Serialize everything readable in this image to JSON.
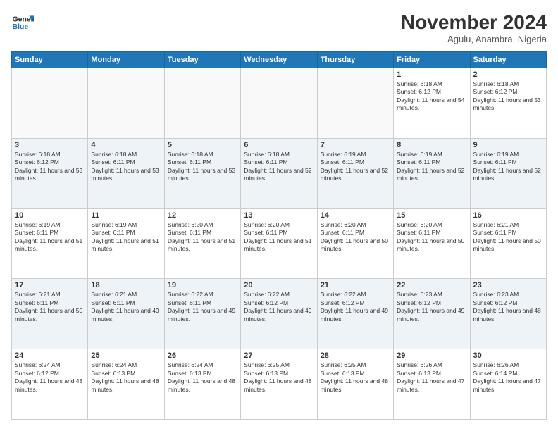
{
  "header": {
    "logo_line1": "General",
    "logo_line2": "Blue",
    "month": "November 2024",
    "location": "Agulu, Anambra, Nigeria"
  },
  "weekdays": [
    "Sunday",
    "Monday",
    "Tuesday",
    "Wednesday",
    "Thursday",
    "Friday",
    "Saturday"
  ],
  "weeks": [
    [
      {
        "day": "",
        "empty": true
      },
      {
        "day": "",
        "empty": true
      },
      {
        "day": "",
        "empty": true
      },
      {
        "day": "",
        "empty": true
      },
      {
        "day": "",
        "empty": true
      },
      {
        "day": "1",
        "rise": "6:18 AM",
        "set": "6:12 PM",
        "daylight": "11 hours and 54 minutes."
      },
      {
        "day": "2",
        "rise": "6:18 AM",
        "set": "6:12 PM",
        "daylight": "11 hours and 53 minutes."
      }
    ],
    [
      {
        "day": "3",
        "rise": "6:18 AM",
        "set": "6:12 PM",
        "daylight": "11 hours and 53 minutes."
      },
      {
        "day": "4",
        "rise": "6:18 AM",
        "set": "6:11 PM",
        "daylight": "11 hours and 53 minutes."
      },
      {
        "day": "5",
        "rise": "6:18 AM",
        "set": "6:11 PM",
        "daylight": "11 hours and 53 minutes."
      },
      {
        "day": "6",
        "rise": "6:18 AM",
        "set": "6:11 PM",
        "daylight": "11 hours and 52 minutes."
      },
      {
        "day": "7",
        "rise": "6:19 AM",
        "set": "6:11 PM",
        "daylight": "11 hours and 52 minutes."
      },
      {
        "day": "8",
        "rise": "6:19 AM",
        "set": "6:11 PM",
        "daylight": "11 hours and 52 minutes."
      },
      {
        "day": "9",
        "rise": "6:19 AM",
        "set": "6:11 PM",
        "daylight": "11 hours and 52 minutes."
      }
    ],
    [
      {
        "day": "10",
        "rise": "6:19 AM",
        "set": "6:11 PM",
        "daylight": "11 hours and 51 minutes."
      },
      {
        "day": "11",
        "rise": "6:19 AM",
        "set": "6:11 PM",
        "daylight": "11 hours and 51 minutes."
      },
      {
        "day": "12",
        "rise": "6:20 AM",
        "set": "6:11 PM",
        "daylight": "11 hours and 51 minutes."
      },
      {
        "day": "13",
        "rise": "6:20 AM",
        "set": "6:11 PM",
        "daylight": "11 hours and 51 minutes."
      },
      {
        "day": "14",
        "rise": "6:20 AM",
        "set": "6:11 PM",
        "daylight": "11 hours and 50 minutes."
      },
      {
        "day": "15",
        "rise": "6:20 AM",
        "set": "6:11 PM",
        "daylight": "11 hours and 50 minutes."
      },
      {
        "day": "16",
        "rise": "6:21 AM",
        "set": "6:11 PM",
        "daylight": "11 hours and 50 minutes."
      }
    ],
    [
      {
        "day": "17",
        "rise": "6:21 AM",
        "set": "6:11 PM",
        "daylight": "11 hours and 50 minutes."
      },
      {
        "day": "18",
        "rise": "6:21 AM",
        "set": "6:11 PM",
        "daylight": "11 hours and 49 minutes."
      },
      {
        "day": "19",
        "rise": "6:22 AM",
        "set": "6:11 PM",
        "daylight": "11 hours and 49 minutes."
      },
      {
        "day": "20",
        "rise": "6:22 AM",
        "set": "6:12 PM",
        "daylight": "11 hours and 49 minutes."
      },
      {
        "day": "21",
        "rise": "6:22 AM",
        "set": "6:12 PM",
        "daylight": "11 hours and 49 minutes."
      },
      {
        "day": "22",
        "rise": "6:23 AM",
        "set": "6:12 PM",
        "daylight": "11 hours and 49 minutes."
      },
      {
        "day": "23",
        "rise": "6:23 AM",
        "set": "6:12 PM",
        "daylight": "11 hours and 48 minutes."
      }
    ],
    [
      {
        "day": "24",
        "rise": "6:24 AM",
        "set": "6:12 PM",
        "daylight": "11 hours and 48 minutes."
      },
      {
        "day": "25",
        "rise": "6:24 AM",
        "set": "6:13 PM",
        "daylight": "11 hours and 48 minutes."
      },
      {
        "day": "26",
        "rise": "6:24 AM",
        "set": "6:13 PM",
        "daylight": "11 hours and 48 minutes."
      },
      {
        "day": "27",
        "rise": "6:25 AM",
        "set": "6:13 PM",
        "daylight": "11 hours and 48 minutes."
      },
      {
        "day": "28",
        "rise": "6:25 AM",
        "set": "6:13 PM",
        "daylight": "11 hours and 48 minutes."
      },
      {
        "day": "29",
        "rise": "6:26 AM",
        "set": "6:13 PM",
        "daylight": "11 hours and 47 minutes."
      },
      {
        "day": "30",
        "rise": "6:26 AM",
        "set": "6:14 PM",
        "daylight": "11 hours and 47 minutes."
      }
    ]
  ],
  "labels": {
    "sunrise": "Sunrise:",
    "sunset": "Sunset:",
    "daylight": "Daylight:"
  }
}
